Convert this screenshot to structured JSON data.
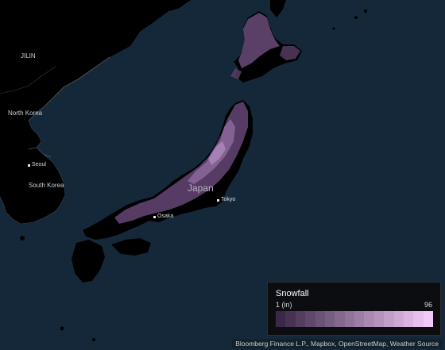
{
  "map": {
    "labels": {
      "jilin": "JILIN",
      "north_korea": "North Korea",
      "south_korea": "South Korea",
      "japan": "Japan"
    },
    "cities": {
      "seoul": "Seoul",
      "tokyo": "Tokyo",
      "osaka": "Osaka"
    },
    "colors": {
      "ocean": "#15283a",
      "land": "#000000",
      "border": "#4a4f55",
      "snow_low": "#3b2748",
      "snow_high": "#f3c9f8"
    }
  },
  "legend": {
    "title": "Snowfall",
    "min_label": "1 (in)",
    "max_label": "96",
    "scale_min": 1,
    "scale_max": 96,
    "unit": "in"
  },
  "attribution": "Bloomberg Finance L.P., Mapbox, OpenStreetMap, Weather Source"
}
